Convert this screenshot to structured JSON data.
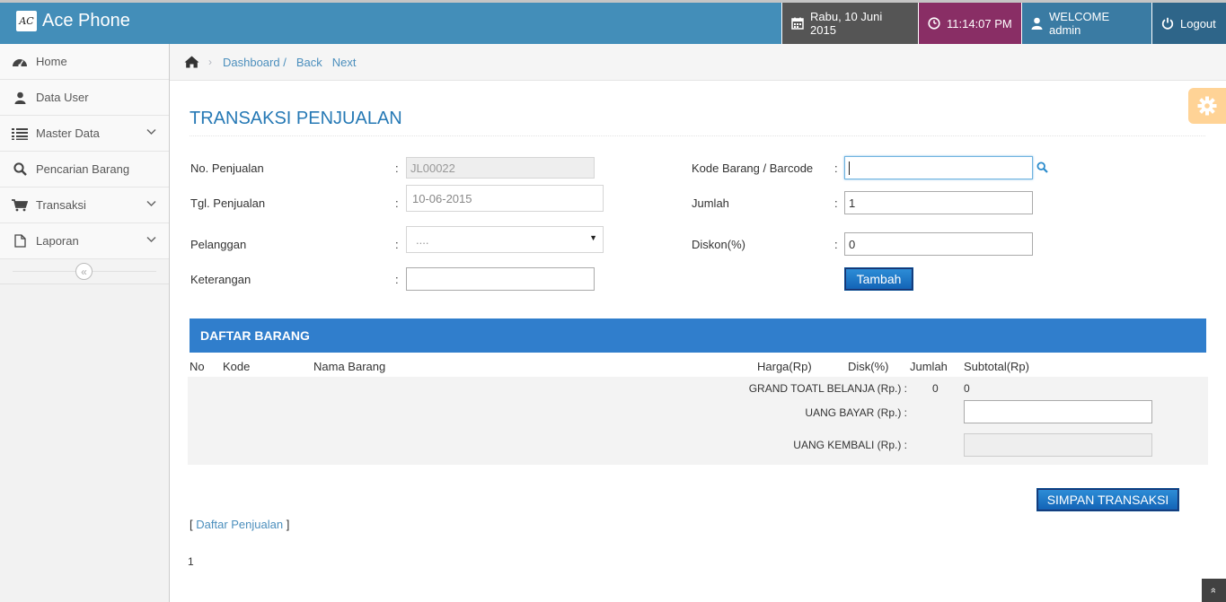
{
  "app": {
    "title": "Ace Phone",
    "logo_text": "AC"
  },
  "navbar": {
    "date": "Rabu, 10 Juni 2015",
    "time": "11:14:07 PM",
    "welcome": "WELCOME admin",
    "logout": "Logout",
    "colors": {
      "bar": "#438eb9",
      "date_bg": "#555555",
      "time_bg": "#892e65",
      "user_bg": "#3a7ba3",
      "logout_bg": "#2e6589"
    }
  },
  "sidebar": {
    "items": [
      {
        "label": "Home",
        "icon": "dashboard-icon"
      },
      {
        "label": "Data User",
        "icon": "user-icon"
      },
      {
        "label": "Master Data",
        "icon": "list-icon",
        "has_submenu": true
      },
      {
        "label": "Pencarian Barang",
        "icon": "search-icon"
      },
      {
        "label": "Transaksi",
        "icon": "cart-icon",
        "has_submenu": true
      },
      {
        "label": "Laporan",
        "icon": "file-icon",
        "has_submenu": true
      }
    ],
    "collapse_glyph": "«"
  },
  "breadcrumb": {
    "dashboard": "Dashboard /",
    "back": "Back",
    "next": "Next"
  },
  "page": {
    "title": "TRANSAKSI PENJUALAN"
  },
  "form": {
    "no_penjualan": {
      "label": "No. Penjualan",
      "value": "JL00022"
    },
    "tgl_penjualan": {
      "label": "Tgl. Penjualan",
      "value": "10-06-2015"
    },
    "pelanggan": {
      "label": "Pelanggan",
      "value": "...."
    },
    "keterangan": {
      "label": "Keterangan",
      "value": ""
    },
    "kode_barang": {
      "label": "Kode Barang / Barcode",
      "value": ""
    },
    "jumlah": {
      "label": "Jumlah",
      "value": "1"
    },
    "diskon": {
      "label": "Diskon(%)",
      "value": "0"
    },
    "colon": ":",
    "tambah_label": "Tambah"
  },
  "daftar": {
    "title": "DAFTAR BARANG",
    "columns": [
      "No",
      "Kode",
      "Nama Barang",
      "Harga(Rp)",
      "Disk(%)",
      "Jumlah",
      "Subtotal(Rp)"
    ],
    "grand_total_label": "GRAND TOATL BELANJA (Rp.) :",
    "grand_total_jumlah": "0",
    "grand_total_subtotal": "0",
    "uang_bayar_label": "UANG BAYAR (Rp.) :",
    "uang_bayar_value": "",
    "uang_kembali_label": "UANG KEMBALI (Rp.) :",
    "uang_kembali_value": ""
  },
  "actions": {
    "simpan_label": "SIMPAN TRANSAKSI"
  },
  "footer": {
    "bracket_open": "[",
    "daftar_penjualan": "Daftar Penjualan",
    "bracket_close": "]",
    "page_number": "1"
  },
  "scroll_top_glyph": "»"
}
